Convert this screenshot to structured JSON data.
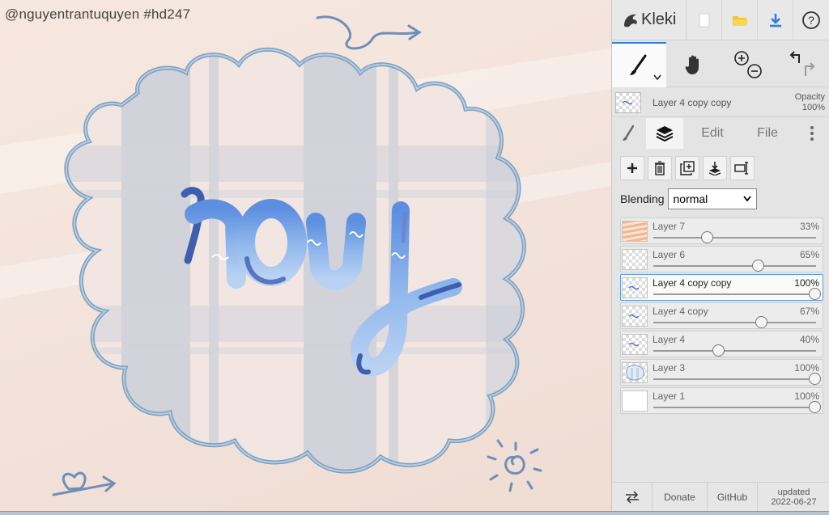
{
  "watermark": "@nguyentrantuquyen  #hd247",
  "artwork_text": "roy",
  "app": {
    "name": "Kleki"
  },
  "current_layer": {
    "name": "Layer 4 copy copy",
    "opacity_label": "Opacity",
    "opacity_value": "100%"
  },
  "tabs": {
    "edit": "Edit",
    "file": "File"
  },
  "blending": {
    "label": "Blending",
    "value": "normal"
  },
  "layers": [
    {
      "name": "Layer 7",
      "opacity": "33%",
      "level": 0.33,
      "thumb": "stripes",
      "selected": false
    },
    {
      "name": "Layer 6",
      "opacity": "65%",
      "level": 0.65,
      "thumb": "empty",
      "selected": false
    },
    {
      "name": "Layer 4 copy copy",
      "opacity": "100%",
      "level": 1.0,
      "thumb": "sketch",
      "selected": true
    },
    {
      "name": "Layer 4 copy",
      "opacity": "67%",
      "level": 0.67,
      "thumb": "sketch",
      "selected": false
    },
    {
      "name": "Layer 4",
      "opacity": "40%",
      "level": 0.4,
      "thumb": "sketch",
      "selected": false
    },
    {
      "name": "Layer 3",
      "opacity": "100%",
      "level": 1.0,
      "thumb": "art",
      "selected": false
    },
    {
      "name": "Layer 1",
      "opacity": "100%",
      "level": 1.0,
      "thumb": "white",
      "selected": false
    }
  ],
  "bottom": {
    "donate": "Donate",
    "github": "GitHub",
    "updated_label": "updated",
    "updated_date": "2022-06-27"
  },
  "colors": {
    "accent": "#2d7fe0",
    "folder": "#f5c52b",
    "cloud_outline": "#7a9fc0",
    "letters": "#6d9be0"
  }
}
